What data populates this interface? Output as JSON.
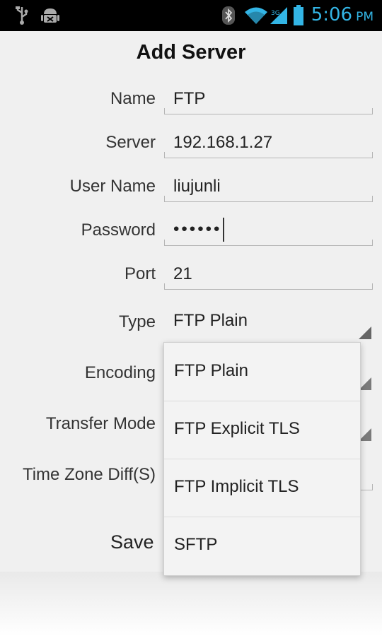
{
  "status_bar": {
    "time": "5:06",
    "ampm": "PM",
    "left_icons": [
      "usb-icon",
      "android-debug-icon"
    ],
    "right_icons": [
      "bluetooth-icon",
      "wifi-icon",
      "signal-icon",
      "battery-icon"
    ],
    "accent_color": "#33b5e5"
  },
  "dialog": {
    "title": "Add Server",
    "fields": {
      "name": {
        "label": "Name",
        "value": "FTP"
      },
      "server": {
        "label": "Server",
        "value": "192.168.1.27"
      },
      "username": {
        "label": "User Name",
        "value": "liujunli"
      },
      "password": {
        "label": "Password",
        "value": "••••••"
      },
      "port": {
        "label": "Port",
        "value": "21"
      }
    },
    "type": {
      "label": "Type",
      "value": "FTP Plain"
    },
    "encoding": {
      "label": "Encoding"
    },
    "transfer_mode": {
      "label": "Transfer Mode"
    },
    "time_zone": {
      "label": "Time Zone Diff(S)"
    },
    "save_label": "Save"
  },
  "dropdown": {
    "options": [
      "FTP Plain",
      "FTP Explicit TLS",
      "FTP Implicit TLS",
      "SFTP"
    ]
  }
}
